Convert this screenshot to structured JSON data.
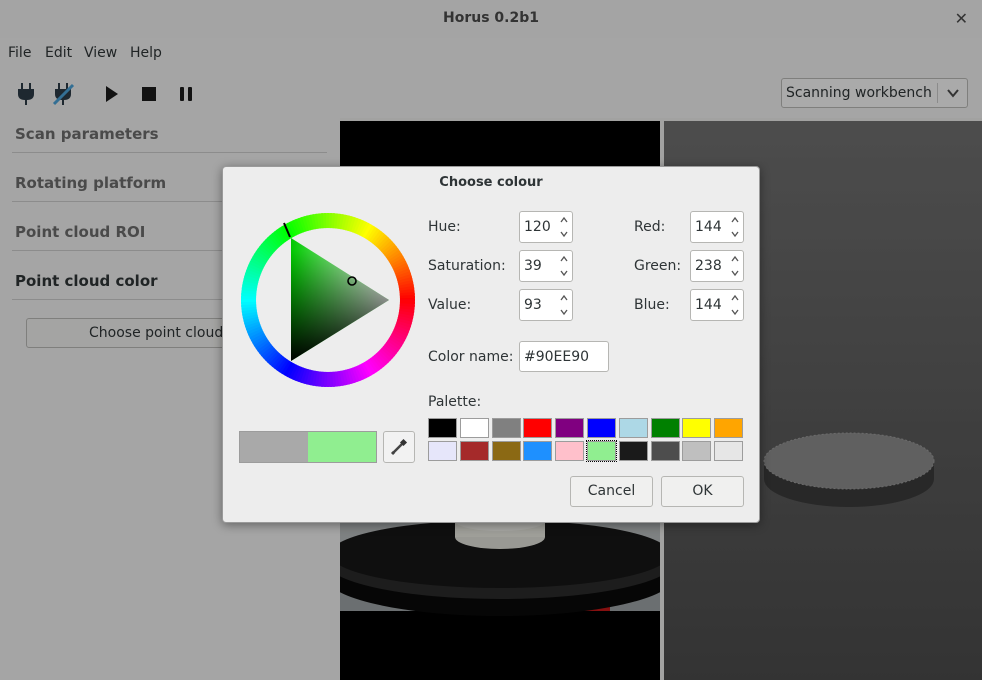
{
  "window": {
    "title": "Horus 0.2b1"
  },
  "menu": [
    "File",
    "Edit",
    "View",
    "Help"
  ],
  "toolbar": {
    "workbench": "Scanning workbench",
    "tools": [
      "connect-icon",
      "disconnect-icon",
      "play-icon",
      "stop-icon",
      "pause-icon"
    ]
  },
  "sidebar": {
    "sections": [
      "Scan parameters",
      "Rotating platform",
      "Point cloud ROI",
      "Point cloud color"
    ],
    "button_label": "Choose point cloud color"
  },
  "dialog": {
    "title": "Choose colour",
    "hue_label": "Hue:",
    "hue": "120",
    "sat_label": "Saturation:",
    "sat": "39",
    "val_label": "Value:",
    "val": "93",
    "red_label": "Red:",
    "red": "144",
    "green_label": "Green:",
    "green": "238",
    "blue_label": "Blue:",
    "blue": "144",
    "name_label": "Color name:",
    "name": "#90EE90",
    "palette_label": "Palette:",
    "palette": [
      "#000000",
      "#ffffff",
      "#808080",
      "#ff0000",
      "#800080",
      "#0000ff",
      "#add8e6",
      "#008000",
      "#ffff00",
      "#ffa500",
      "#e6e6fa",
      "#a52a2a",
      "#8b6914",
      "#1e90ff",
      "#ffc0cb",
      "#90ee90",
      "#1a1a1a",
      "#4d4d4d",
      "#bfbfbf",
      "#e6e6e6"
    ],
    "selected_palette": 15,
    "current_color": "#90EE90",
    "previous_color": "#A9A9A9",
    "cancel": "Cancel",
    "ok": "OK"
  }
}
